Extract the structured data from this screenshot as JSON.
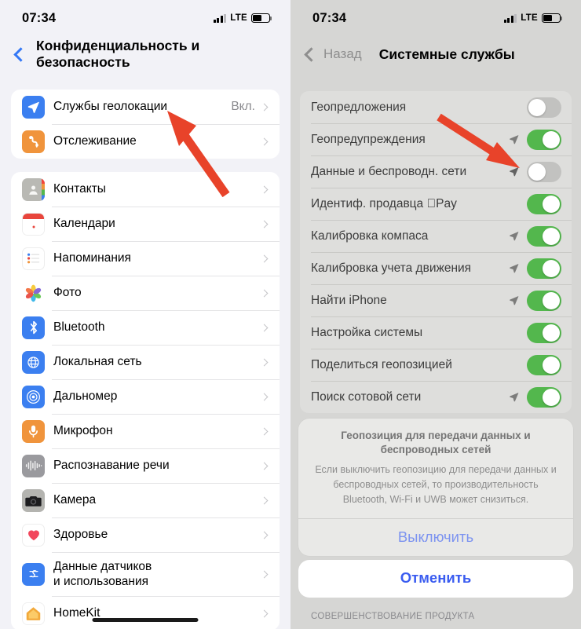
{
  "left": {
    "status": {
      "time": "07:34",
      "network": "LTE",
      "signal_icon": "cellular-bars-icon",
      "battery_icon": "battery-icon"
    },
    "nav": {
      "back_icon": "back-chevron-icon",
      "title": "Конфиденциальность и безопасность"
    },
    "group1": [
      {
        "label": "Службы геолокации",
        "value": "Вкл.",
        "icon": "location-services-icon",
        "icon_color": "#3b7ff0"
      },
      {
        "label": "Отслеживание",
        "value": "",
        "icon": "tracking-icon",
        "icon_color": "#f0943c"
      }
    ],
    "group2": [
      {
        "label": "Контакты",
        "icon": "contacts-icon",
        "icon_color": "#b5b5b0"
      },
      {
        "label": "Календари",
        "icon": "calendar-icon",
        "icon_color": "#ffffff"
      },
      {
        "label": "Напоминания",
        "icon": "reminders-icon",
        "icon_color": "#ffffff"
      },
      {
        "label": "Фото",
        "icon": "photos-icon",
        "icon_color": "#ffffff"
      },
      {
        "label": "Bluetooth",
        "icon": "bluetooth-icon",
        "icon_color": "#3b7ff0"
      },
      {
        "label": "Локальная сеть",
        "icon": "local-network-icon",
        "icon_color": "#3b7ff0"
      },
      {
        "label": "Дальномер",
        "icon": "measure-icon",
        "icon_color": "#3b7ff0"
      },
      {
        "label": "Микрофон",
        "icon": "microphone-icon",
        "icon_color": "#f0943c"
      },
      {
        "label": "Распознавание речи",
        "icon": "speech-recognition-icon",
        "icon_color": "#9a9a9e"
      },
      {
        "label": "Камера",
        "icon": "camera-icon",
        "icon_color": "#6e6e73"
      },
      {
        "label": "Здоровье",
        "icon": "health-icon",
        "icon_color": "#ffffff"
      },
      {
        "label": "Данные датчиков\nи использования",
        "icon": "sensor-data-icon",
        "icon_color": "#3b7ff0"
      },
      {
        "label": "HomeKit",
        "icon": "homekit-icon",
        "icon_color": "#f5c45e"
      }
    ]
  },
  "right": {
    "status": {
      "time": "07:34",
      "network": "LTE",
      "signal_icon": "cellular-bars-icon",
      "battery_icon": "battery-icon"
    },
    "nav": {
      "back_icon": "back-chevron-icon",
      "back_label": "Назад",
      "title": "Системные службы"
    },
    "rows": [
      {
        "label": "Геопредложения",
        "toggle": "off",
        "arrow": false
      },
      {
        "label": "Геопредупреждения",
        "toggle": "on",
        "arrow": true
      },
      {
        "label": "Данные и беспроводн. сети",
        "toggle": "off",
        "arrow": true
      },
      {
        "label": "Идентиф. продавца Pay",
        "toggle": "on",
        "arrow": false
      },
      {
        "label": "Калибровка компаса",
        "toggle": "on",
        "arrow": true
      },
      {
        "label": "Калибровка учета движения",
        "toggle": "on",
        "arrow": true
      },
      {
        "label": "Найти iPhone",
        "toggle": "on",
        "arrow": true
      },
      {
        "label": "Настройка системы",
        "toggle": "on",
        "arrow": false
      },
      {
        "label": "Поделиться геопозицией",
        "toggle": "on",
        "arrow": false
      },
      {
        "label": "Поиск сотовой сети",
        "toggle": "on",
        "arrow": true
      }
    ],
    "alert": {
      "title": "Геопозиция для передачи данных и беспроводных сетей",
      "message": "Если выключить геопозицию для передачи данных и беспроводных сетей, то производительность Bluetooth, Wi-Fi и UWB может снизиться.",
      "confirm_label": "Выключить",
      "cancel_label": "Отменить"
    },
    "footer_caption": "СОВЕРШЕНСТВОВАНИЕ ПРОДУКТА"
  },
  "annotations": {
    "arrow_color": "#e8432a",
    "arrow_left_name": "annotation-arrow-location-services",
    "arrow_right_name": "annotation-arrow-data-wireless-toggle"
  }
}
